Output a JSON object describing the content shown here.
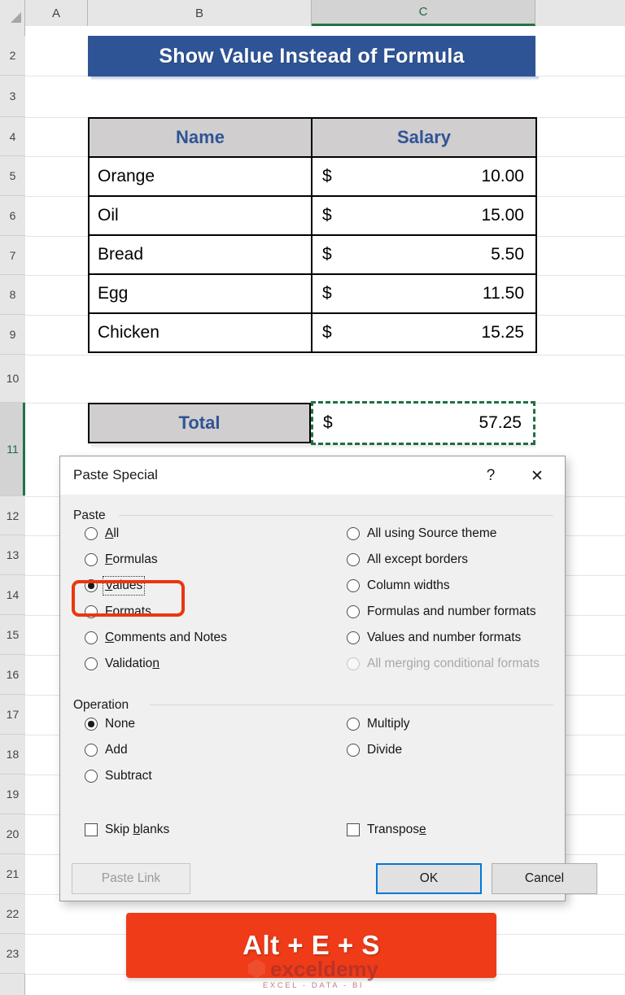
{
  "spreadsheet": {
    "column_headers": [
      "A",
      "B",
      "C"
    ],
    "active_column": "C",
    "row_headers": [
      "2",
      "3",
      "4",
      "5",
      "6",
      "7",
      "8",
      "9",
      "10",
      "11",
      "12",
      "13",
      "14",
      "15",
      "16",
      "17",
      "18",
      "19",
      "20",
      "21",
      "22",
      "23"
    ],
    "active_row": "11",
    "title_banner": "Show Value Instead of Formula",
    "title_banner_color": "#2F5496"
  },
  "table": {
    "headers": [
      "Name",
      "Salary"
    ],
    "header_bg": "#D0CECE",
    "header_text_color": "#2F5496",
    "rows": [
      {
        "name": "Orange",
        "currency": "$",
        "amount": "10.00"
      },
      {
        "name": "Oil",
        "currency": "$",
        "amount": "15.00"
      },
      {
        "name": "Bread",
        "currency": "$",
        "amount": "5.50"
      },
      {
        "name": "Egg",
        "currency": "$",
        "amount": "11.50"
      },
      {
        "name": "Chicken",
        "currency": "$",
        "amount": "15.25"
      }
    ],
    "total": {
      "label": "Total",
      "currency": "$",
      "amount": "57.25"
    },
    "selection_border_color": "#1E7145"
  },
  "dialog": {
    "title": "Paste Special",
    "help_icon": "question-mark-icon",
    "close_icon": "close-x-icon",
    "paste_group_label": "Paste",
    "paste_options_left": [
      {
        "label": "All",
        "accel": "A",
        "selected": false,
        "disabled": false
      },
      {
        "label": "Formulas",
        "accel": "F",
        "selected": false,
        "disabled": false
      },
      {
        "label": "Values",
        "accel": "V",
        "selected": true,
        "disabled": false
      },
      {
        "label": "Formats",
        "accel": "t",
        "selected": false,
        "disabled": false
      },
      {
        "label": "Comments and Notes",
        "accel": "C",
        "selected": false,
        "disabled": false
      },
      {
        "label": "Validation",
        "accel": "n",
        "selected": false,
        "disabled": false
      }
    ],
    "paste_options_right": [
      {
        "label": "All using Source theme",
        "selected": false,
        "disabled": false
      },
      {
        "label": "All except borders",
        "selected": false,
        "disabled": false
      },
      {
        "label": "Column widths",
        "selected": false,
        "disabled": false
      },
      {
        "label": "Formulas and number formats",
        "selected": false,
        "disabled": false
      },
      {
        "label": "Values and number formats",
        "selected": false,
        "disabled": false
      },
      {
        "label": "All merging conditional formats",
        "selected": false,
        "disabled": true
      }
    ],
    "operation_group_label": "Operation",
    "operation_options_left": [
      {
        "label": "None",
        "selected": true
      },
      {
        "label": "Add",
        "selected": false
      },
      {
        "label": "Subtract",
        "selected": false
      }
    ],
    "operation_options_right": [
      {
        "label": "Multiply",
        "selected": false
      },
      {
        "label": "Divide",
        "selected": false
      }
    ],
    "checkboxes": [
      {
        "label": "Skip blanks",
        "checked": false
      },
      {
        "label": "Transpose",
        "checked": false
      }
    ],
    "buttons": {
      "paste_link": "Paste Link",
      "paste_link_disabled": true,
      "ok": "OK",
      "ok_focused": true,
      "cancel": "Cancel"
    },
    "highlight_color": "#E8380D"
  },
  "shortcut_banner": {
    "text": "Alt + E + S",
    "bg_color": "#EF3B18"
  },
  "watermark": {
    "name": "exceldemy",
    "tagline": "EXCEL - DATA - BI"
  }
}
